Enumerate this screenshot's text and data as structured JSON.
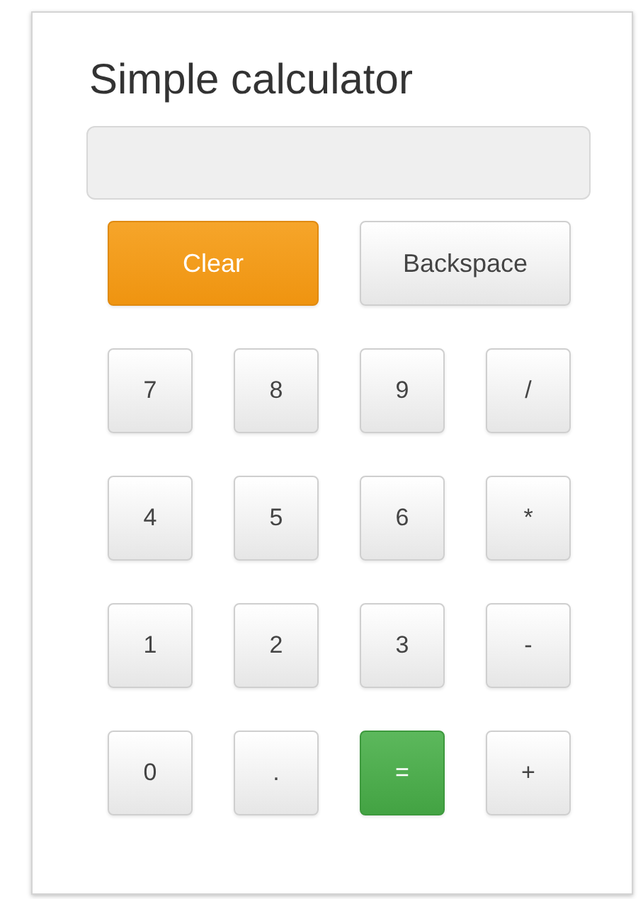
{
  "title": "Simple calculator",
  "actions": [
    {
      "label": "Clear",
      "kind": "clear"
    },
    {
      "label": "Backspace",
      "kind": "plain"
    }
  ],
  "keys": [
    {
      "label": "7",
      "kind": "plain"
    },
    {
      "label": "8",
      "kind": "plain"
    },
    {
      "label": "9",
      "kind": "plain"
    },
    {
      "label": "/",
      "kind": "plain"
    },
    {
      "label": "4",
      "kind": "plain"
    },
    {
      "label": "5",
      "kind": "plain"
    },
    {
      "label": "6",
      "kind": "plain"
    },
    {
      "label": "*",
      "kind": "plain"
    },
    {
      "label": "1",
      "kind": "plain"
    },
    {
      "label": "2",
      "kind": "plain"
    },
    {
      "label": "3",
      "kind": "plain"
    },
    {
      "label": "-",
      "kind": "plain"
    },
    {
      "label": "0",
      "kind": "plain"
    },
    {
      "label": ".",
      "kind": "plain"
    },
    {
      "label": "=",
      "kind": "equals"
    },
    {
      "label": "+",
      "kind": "plain"
    }
  ]
}
